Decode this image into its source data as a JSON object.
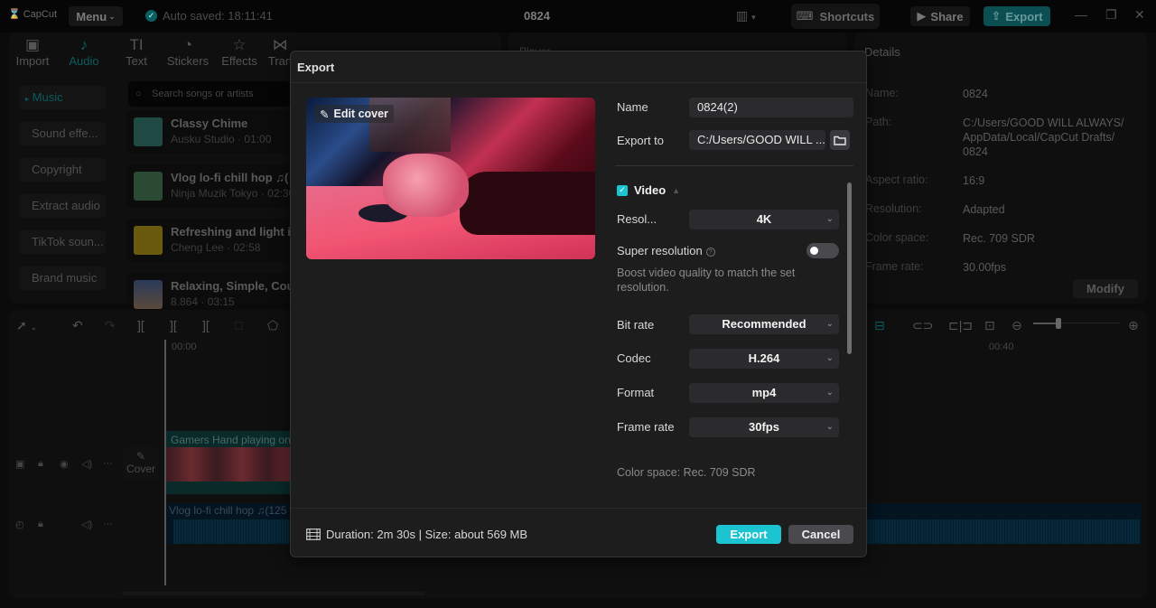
{
  "app": {
    "logo": "CapCut",
    "menu_label": "Menu",
    "autosave": "Auto saved: 18:11:41",
    "project_title": "0824",
    "shortcuts_label": "Shortcuts",
    "share_label": "Share",
    "export_label": "Export"
  },
  "toolbar": {
    "tabs": [
      {
        "label": "Import",
        "icon": "import-icon"
      },
      {
        "label": "Audio",
        "icon": "music-note-icon",
        "active": true
      },
      {
        "label": "Text",
        "icon": "text-icon"
      },
      {
        "label": "Stickers",
        "icon": "sticker-icon"
      },
      {
        "label": "Effects",
        "icon": "effects-icon"
      },
      {
        "label": "Tran",
        "icon": "transition-icon"
      }
    ]
  },
  "audio_sidebar": {
    "items": [
      "Music",
      "Sound effe...",
      "Copyright",
      "Extract audio",
      "TikTok soun...",
      "Brand music"
    ],
    "active": "Music"
  },
  "music_panel": {
    "search_placeholder": "Search songs or artists",
    "songs": [
      {
        "title": "Classy Chime",
        "meta": "Ausku Studio · 01:00"
      },
      {
        "title": "Vlog  lo-fi chill hop ♫(",
        "meta": "Ninja Muzik Tokyo · 02:30"
      },
      {
        "title": "Refreshing and light i",
        "meta": "Cheng Lee · 02:58"
      },
      {
        "title": "Relaxing, Simple, Cou",
        "meta": "8.864 · 03:15"
      }
    ]
  },
  "player": {
    "title": "Player"
  },
  "details": {
    "title": "Details",
    "rows": [
      {
        "label": "Name:",
        "value": "0824"
      },
      {
        "label": "Path:",
        "value": "C:/Users/GOOD WILL ALWAYS/ AppData/Local/CapCut Drafts/ 0824"
      },
      {
        "label": "Aspect ratio:",
        "value": "16:9"
      },
      {
        "label": "Resolution:",
        "value": "Adapted"
      },
      {
        "label": "Color space:",
        "value": "Rec. 709 SDR"
      },
      {
        "label": "Frame rate:",
        "value": "30.00fps"
      }
    ],
    "modify_label": "Modify"
  },
  "timeline": {
    "time_start": "00:00",
    "time_mark": "00:40",
    "cover_label": "Cover",
    "video_clip": "Gamers Hand playing on",
    "audio_clip": "Vlog  lo-fi chill hop ♫(125"
  },
  "dialog": {
    "title": "Export",
    "edit_cover": "Edit cover",
    "name_label": "Name",
    "name_value": "0824(2)",
    "export_to_label": "Export to",
    "export_to_value": "C:/Users/GOOD WILL ...",
    "video_section": "Video",
    "video_checked": true,
    "resolution_label": "Resol...",
    "resolution_value": "4K",
    "super_resolution_label": "Super resolution",
    "super_resolution_on": false,
    "super_resolution_hint": "Boost video quality to match the set resolution.",
    "bitrate_label": "Bit rate",
    "bitrate_value": "Recommended",
    "codec_label": "Codec",
    "codec_value": "H.264",
    "format_label": "Format",
    "format_value": "mp4",
    "framerate_label": "Frame rate",
    "framerate_value": "30fps",
    "color_space": "Color space: Rec. 709 SDR",
    "footer_info": "Duration: 2m 30s | Size: about 569 MB",
    "export_button": "Export",
    "cancel_button": "Cancel"
  },
  "colors": {
    "accent": "#1cc3d0",
    "dialog_bg": "#1d1d1d",
    "field_bg": "#2b2b2e"
  }
}
